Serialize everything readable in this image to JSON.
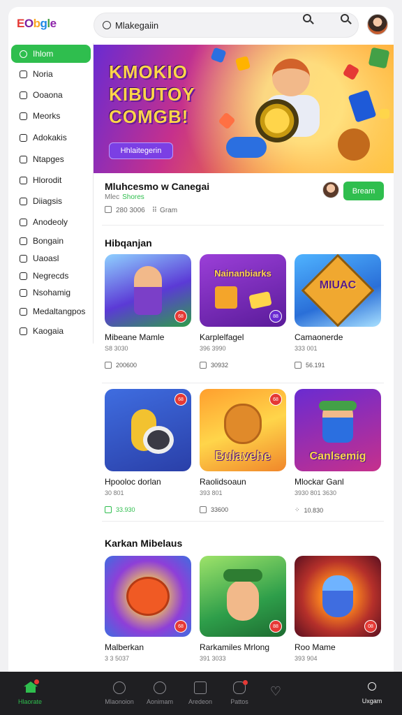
{
  "header": {
    "logo_letters": [
      "E",
      "O",
      "b",
      "g",
      "l",
      "e"
    ],
    "search_value": "Mlakegaiin"
  },
  "sidebar": {
    "items": [
      {
        "label": "Ihlom",
        "icon": "search-icon",
        "active": true
      },
      {
        "label": "Noria",
        "icon": "page-icon"
      },
      {
        "label": "Ooaona",
        "icon": "calendar-icon"
      },
      {
        "label": "Meorks",
        "icon": "pen-icon"
      },
      {
        "label": "Adokakis",
        "icon": "search-icon"
      },
      {
        "label": "Ntapges",
        "icon": "grid-icon"
      },
      {
        "label": "Hlorodit",
        "icon": "page-icon"
      },
      {
        "label": "Diiagsis",
        "icon": "file-icon"
      },
      {
        "label": "Anodeoly",
        "icon": "calendar-icon"
      },
      {
        "label": "Bongain",
        "icon": "search-icon"
      },
      {
        "label": "Uaoasl",
        "icon": "list-icon"
      },
      {
        "label": "Negrecds",
        "icon": "grid-icon"
      },
      {
        "label": "Nsohamig",
        "icon": "grid-icon"
      },
      {
        "label": "Medaltangpos",
        "icon": "shield-icon"
      },
      {
        "label": "Kaogaia",
        "icon": "monitor-icon"
      }
    ]
  },
  "hero": {
    "line1": "KMOKIO",
    "line2": "KIBUTOY",
    "line3": "COMGB!",
    "cta": "Hhlaitegerin"
  },
  "featured": {
    "title": "Mluhcesmo w Canegai",
    "sub_a": "Mlec",
    "sub_b": "Shores",
    "meta_a": "280 3006",
    "meta_b": "Gram",
    "button": "Bream"
  },
  "sections": [
    {
      "title": "Hibqanjan",
      "cards": [
        {
          "title": "Mibeane Mamle",
          "sub": "S8 3030",
          "meta": "200600",
          "meta_green": false,
          "thumb_text": "",
          "badge": "68"
        },
        {
          "title": "Karplelfagel",
          "sub": "396 3990",
          "meta": "30932",
          "meta_green": false,
          "thumb_text": "Nainanbiarks",
          "badge": "88"
        },
        {
          "title": "Camaonerde",
          "sub": "333 001",
          "meta": "56.191",
          "meta_green": false,
          "thumb_text": "MIUAC",
          "badge": ""
        }
      ]
    },
    {
      "title": "",
      "cards": [
        {
          "title": "Hpooloc dorlan",
          "sub": "30 801",
          "meta": "33.930",
          "meta_green": true,
          "thumb_text": "",
          "badge": "68"
        },
        {
          "title": "Raolidsoaun",
          "sub": "393 801",
          "meta": "33600",
          "meta_green": false,
          "thumb_text": "Bulavehe",
          "badge": "68"
        },
        {
          "title": "Mlockar Ganl",
          "sub": "3930 801 3630 ",
          "meta": "10.830",
          "meta_green": false,
          "thumb_text": "Canlsemig",
          "badge": ""
        }
      ]
    },
    {
      "title": "Karkan Mibelaus",
      "cards": [
        {
          "title": "Malberkan",
          "sub": "3 3 5037",
          "meta": "",
          "meta_green": false,
          "thumb_text": "",
          "badge": "68"
        },
        {
          "title": "Rarkamiles Mrlong",
          "sub": "391 3033",
          "meta": "",
          "meta_green": false,
          "thumb_text": "",
          "badge": "88"
        },
        {
          "title": "Roo Mame",
          "sub": "393 904",
          "meta": "",
          "meta_green": false,
          "thumb_text": "",
          "badge": "08"
        }
      ]
    }
  ],
  "bottom_nav": [
    {
      "label": "Hlaorate",
      "icon": "home-icon",
      "active": true
    },
    {
      "label": "Mlaonoion",
      "icon": "rocket-icon"
    },
    {
      "label": "Aonimam",
      "icon": "search-icon"
    },
    {
      "label": "Aredeon",
      "icon": "tablet-icon"
    },
    {
      "label": "Pattos",
      "icon": "chat-icon"
    },
    {
      "label": "",
      "icon": "heart-icon"
    },
    {
      "label": "Uxgam",
      "icon": "user-icon"
    }
  ],
  "colors": {
    "accent": "#2fbe4e",
    "badge": "#e53935",
    "nav_bg": "#1f1f22"
  }
}
